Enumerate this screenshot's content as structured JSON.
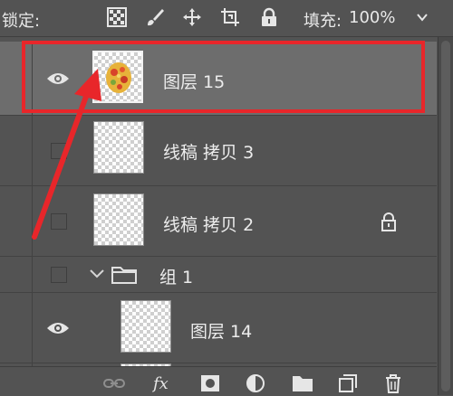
{
  "toolbar": {
    "lock_label": "锁定:",
    "fill_label": "填充:",
    "fill_value": "100%",
    "icons": [
      "lock-transparent-pixels-icon",
      "lock-image-pixels-icon",
      "lock-position-icon",
      "lock-artboard-icon",
      "lock-all-icon",
      "dropdown-caret-icon"
    ]
  },
  "layers": [
    {
      "name": "图层 15",
      "selected": true,
      "visible": true,
      "locked": false,
      "type": "layer"
    },
    {
      "name": "线稿 拷贝 3",
      "selected": false,
      "visible": false,
      "locked": false,
      "type": "layer"
    },
    {
      "name": "线稿 拷贝 2",
      "selected": false,
      "visible": false,
      "locked": true,
      "type": "layer"
    },
    {
      "name": "组 1",
      "selected": false,
      "visible": false,
      "locked": false,
      "type": "group",
      "expanded": true
    },
    {
      "name": "图层 14",
      "selected": false,
      "visible": true,
      "locked": false,
      "type": "layer",
      "indent": 1
    }
  ],
  "footer_icons": [
    "link-layers-icon",
    "fx-icon",
    "add-mask-icon",
    "adjustment-layer-icon",
    "new-group-icon",
    "new-layer-icon",
    "delete-icon"
  ],
  "annotation": {
    "color": "#e8262a"
  }
}
